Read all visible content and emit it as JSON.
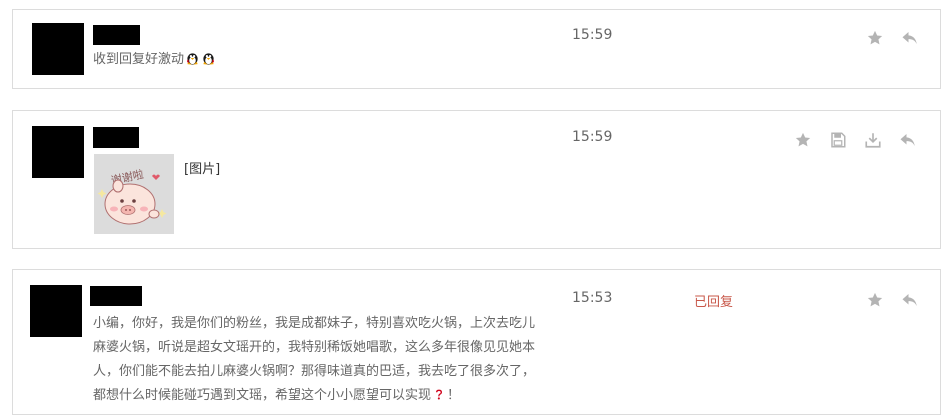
{
  "messages": [
    {
      "time": "15:59",
      "text": "收到回复好激动",
      "emojis": [
        "penguin-emoji",
        "penguin-emoji"
      ],
      "actions": [
        "star-icon",
        "reply-icon"
      ]
    },
    {
      "time": "15:59",
      "image_caption": "谢谢啦",
      "image_tag": "[图片]",
      "actions": [
        "star-icon",
        "save-icon",
        "download-icon",
        "reply-icon"
      ]
    },
    {
      "time": "15:53",
      "status": "已回复",
      "lines": [
        "小编，你好，我是你们的粉丝，我是成都妹子，特别喜欢吃火锅，上次去吃儿",
        "麻婆火锅，听说是超女文瑶开的，我特别稀饭她唱歌，这么多年很像见见她本",
        "人，你们能不能去拍儿麻婆火锅啊？那得味道真的巴适，我去吃了很多次了，",
        "都想什么时候能碰巧遇到文瑶，希望这个小小愿望可以实现"
      ],
      "line_end": "！",
      "emoji": "question-mark-emoji",
      "actions": [
        "star-icon",
        "reply-icon"
      ]
    }
  ],
  "colors": {
    "icon": "#b4b4b4",
    "status": "#c8584a",
    "text": "#666666",
    "border": "#dcdcdc"
  }
}
